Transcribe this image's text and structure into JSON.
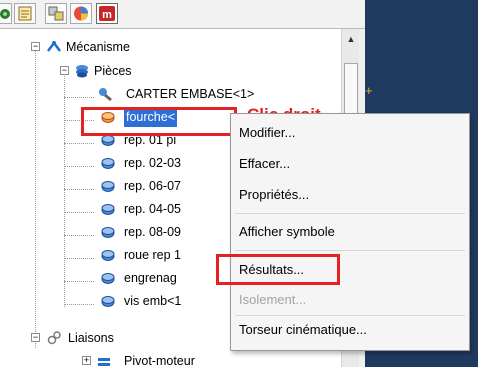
{
  "toolbar": {
    "buttons": [
      {
        "name": "tree-view-icon",
        "active": false
      },
      {
        "name": "properties-icon",
        "active": false
      },
      {
        "name": "config-icon",
        "active": false
      },
      {
        "name": "display-icon",
        "active": false
      },
      {
        "name": "mechanism-icon",
        "active": true
      }
    ]
  },
  "tree": {
    "root": {
      "label": "Mécanisme",
      "expander": "−"
    },
    "pieces": {
      "label": "Pièces",
      "expander": "−"
    },
    "items": [
      {
        "label": "CARTER EMBASE<1>"
      },
      {
        "label": "fourche<",
        "selected": true
      },
      {
        "label": "rep. 01 pi"
      },
      {
        "label": "rep. 02-03"
      },
      {
        "label": "rep. 06-07"
      },
      {
        "label": "rep. 04-05"
      },
      {
        "label": "rep. 08-09"
      },
      {
        "label": "roue rep 1"
      },
      {
        "label": "engrenag"
      },
      {
        "label": "vis emb<1"
      }
    ],
    "liaisons": {
      "label": "Liaisons",
      "expander": "−"
    },
    "liaison_items": [
      {
        "label": "Pivot-moteur",
        "expander": "+"
      }
    ]
  },
  "annotation": {
    "text": "Clic droit",
    "color": "#e32222"
  },
  "context_menu": {
    "items": [
      {
        "label": "Modifier...",
        "enabled": true
      },
      {
        "label": "Effacer...",
        "enabled": true
      },
      {
        "label": "Propriétés...",
        "enabled": true
      },
      {
        "label": "Afficher symbole",
        "enabled": true
      },
      {
        "label": "Résultats...",
        "enabled": true,
        "highlighted": true
      },
      {
        "label": "Isolement...",
        "enabled": false
      },
      {
        "label": "Torseur cinématique...",
        "enabled": true
      }
    ]
  },
  "canvas": {
    "marker": "+",
    "background": "#1f3a5f"
  },
  "colors": {
    "accent_red": "#e32222",
    "selection_blue": "#2e6fd6"
  }
}
